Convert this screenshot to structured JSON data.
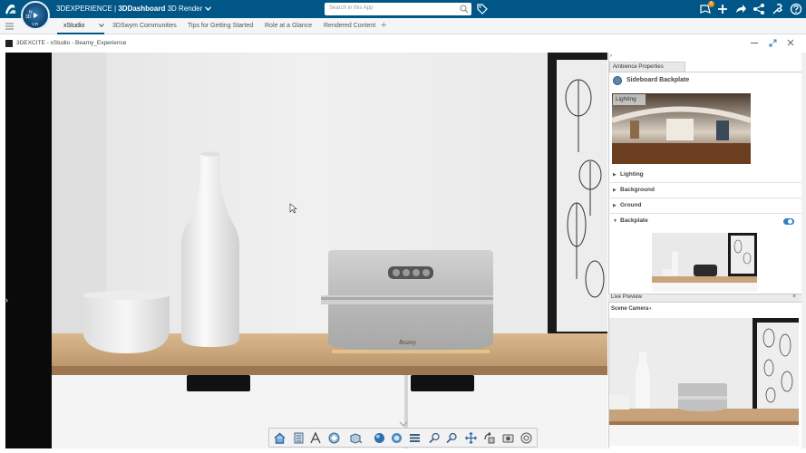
{
  "topbar": {
    "brand_prefix": "3DEXPERIENCE",
    "brand_separator": "|",
    "brand_app": "3DDashboard",
    "brand_module": "3D Render",
    "search_placeholder": "Search in this App",
    "notification_count": "6",
    "compass_version": "V,R",
    "icons": [
      "ds-logo-icon",
      "compass-icon",
      "chevron-down-icon",
      "search-icon",
      "tag-icon",
      "notifications-icon",
      "add-icon",
      "share-icon",
      "network-icon",
      "tools-icon",
      "help-icon"
    ]
  },
  "tabs": [
    {
      "label": "xStudio",
      "active": true
    },
    {
      "label": "3DSwym Communities"
    },
    {
      "label": "Tips for Getting Started"
    },
    {
      "label": "Role at a Glance"
    },
    {
      "label": "Rendered Content"
    }
  ],
  "tab_add": "+",
  "window": {
    "title": "3DEXCITE - xStudio - Beamy_Experience"
  },
  "right_panel": {
    "collapse_glyph": "›",
    "tab_label": "Ambience Properties",
    "backplate_name": "Sideboard Backplate",
    "hdri_label": "Lighting",
    "sections": [
      {
        "label": "Lighting",
        "expanded": false
      },
      {
        "label": "Background",
        "expanded": false
      },
      {
        "label": "Ground",
        "expanded": false
      },
      {
        "label": "Backplate",
        "expanded": true,
        "toggle_on": true
      }
    ],
    "live_preview_label": "Live Preview",
    "live_close": "×",
    "camera_label": "Scene Camera",
    "camera_caret": "▾"
  },
  "viewport": {
    "left_expand_glyph": "›",
    "speaker_brand": "Beamy"
  },
  "toolbar": {
    "buttons": [
      "home-icon",
      "model-tree-icon",
      "annotate-icon",
      "render-icon",
      "view-mode-icon",
      "shading-icon",
      "material-icon",
      "layers-icon",
      "zoom-icon",
      "zoom-area-icon",
      "pan-icon",
      "rotate-icon",
      "snapshot-icon",
      "capture-icon"
    ]
  },
  "colors": {
    "topbar": "#005686",
    "accent": "#2f80c3",
    "badge": "#e88a1b"
  }
}
